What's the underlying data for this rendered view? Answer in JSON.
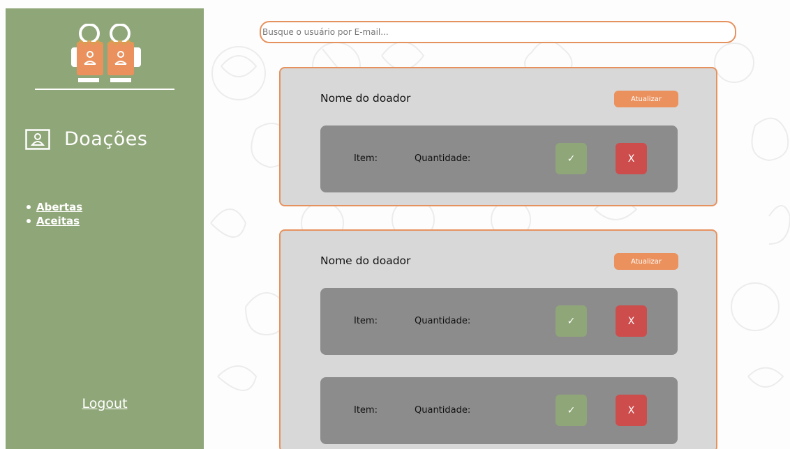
{
  "search": {
    "placeholder": "Busque o usuário por E-mail..."
  },
  "sidebar": {
    "section_title": "Doações",
    "nav": [
      {
        "label": "Abertas"
      },
      {
        "label": "Aceitas"
      }
    ],
    "logout_label": "Logout"
  },
  "donations": [
    {
      "donor_label": "Nome do doador",
      "update_label": "Atualizar",
      "items": [
        {
          "item_label": "Item:",
          "quantity_label": "Quantidade:",
          "accept_label": "✓",
          "reject_label": "X"
        }
      ]
    },
    {
      "donor_label": "Nome do doador",
      "update_label": "Atualizar",
      "items": [
        {
          "item_label": "Item:",
          "quantity_label": "Quantidade:",
          "accept_label": "✓",
          "reject_label": "X"
        },
        {
          "item_label": "Item:",
          "quantity_label": "Quantidade:",
          "accept_label": "✓",
          "reject_label": "X"
        }
      ]
    }
  ],
  "colors": {
    "sidebar": "#8fa678",
    "accent_orange": "#e6925f",
    "card_bg": "#d8d8d8",
    "item_bg": "#8c8c8c",
    "accept": "#8fa678",
    "reject": "#cd4c4c"
  },
  "icons": {
    "logo": "two-food-bags-logo",
    "section": "user-card-icon",
    "accept": "check-icon",
    "reject": "x-icon"
  }
}
